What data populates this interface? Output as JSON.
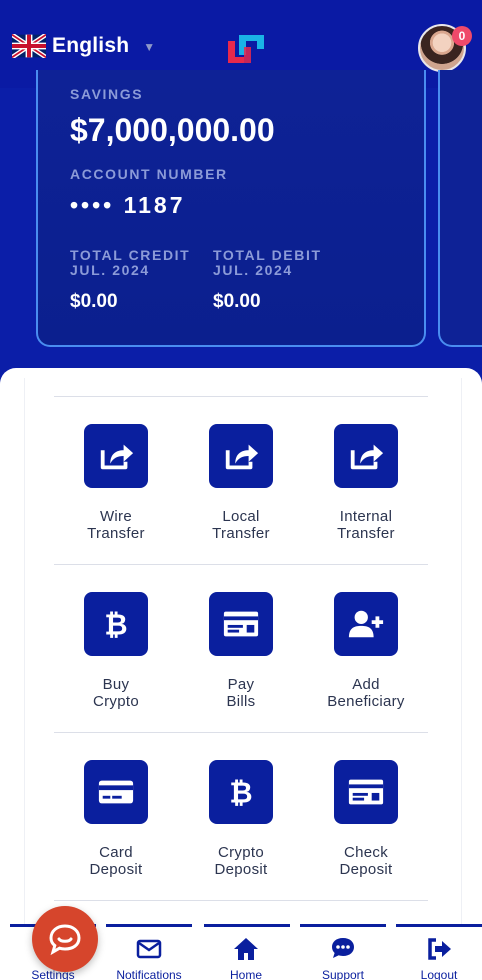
{
  "header": {
    "language": "English",
    "notification_count": "0",
    "icons": {
      "flag": "uk-flag-icon",
      "caret": "caret-down-icon",
      "logo": "bank-logo",
      "avatar": "user-avatar"
    }
  },
  "account_card": {
    "type_label": "SAVINGS",
    "balance": "$7,000,000.00",
    "account_number_label": "ACCOUNT NUMBER",
    "account_number_masked": "•••• 1187",
    "total_credit_label": "TOTAL CREDIT",
    "total_credit_period": "JUL. 2024",
    "total_credit_value": "$0.00",
    "total_debit_label": "TOTAL DEBIT",
    "total_debit_period": "JUL. 2024",
    "total_debit_value": "$0.00"
  },
  "actions": [
    {
      "line1": "Wire",
      "line2": "Transfer",
      "icon": "share-square-icon"
    },
    {
      "line1": "Local",
      "line2": "Transfer",
      "icon": "share-square-icon"
    },
    {
      "line1": "Internal",
      "line2": "Transfer",
      "icon": "share-square-icon"
    },
    {
      "line1": "Buy",
      "line2": "Crypto",
      "icon": "bitcoin-icon"
    },
    {
      "line1": "Pay",
      "line2": "Bills",
      "icon": "bill-card-icon"
    },
    {
      "line1": "Add",
      "line2": "Beneficiary",
      "icon": "user-plus-icon"
    },
    {
      "line1": "Card",
      "line2": "Deposit",
      "icon": "credit-card-icon"
    },
    {
      "line1": "Crypto",
      "line2": "Deposit",
      "icon": "bitcoin-icon"
    },
    {
      "line1": "Check",
      "line2": "Deposit",
      "icon": "bill-card-icon"
    }
  ],
  "bottom_nav": [
    {
      "label": "Settings",
      "icon": "gear-icon"
    },
    {
      "label": "Notifications",
      "icon": "envelope-icon"
    },
    {
      "label": "Home",
      "icon": "home-icon"
    },
    {
      "label": "Support",
      "icon": "chat-dots-icon"
    },
    {
      "label": "Logout",
      "icon": "logout-icon"
    }
  ],
  "chat_widget": {
    "icon": "chat-bubble-icon"
  },
  "colors": {
    "brand_blue": "#0a1f9e",
    "accent_border": "#4a8df0",
    "badge": "#ef4a6a",
    "chat_button": "#d6452c",
    "logo_red": "#e8294c",
    "logo_cyan": "#1ab3e6"
  }
}
